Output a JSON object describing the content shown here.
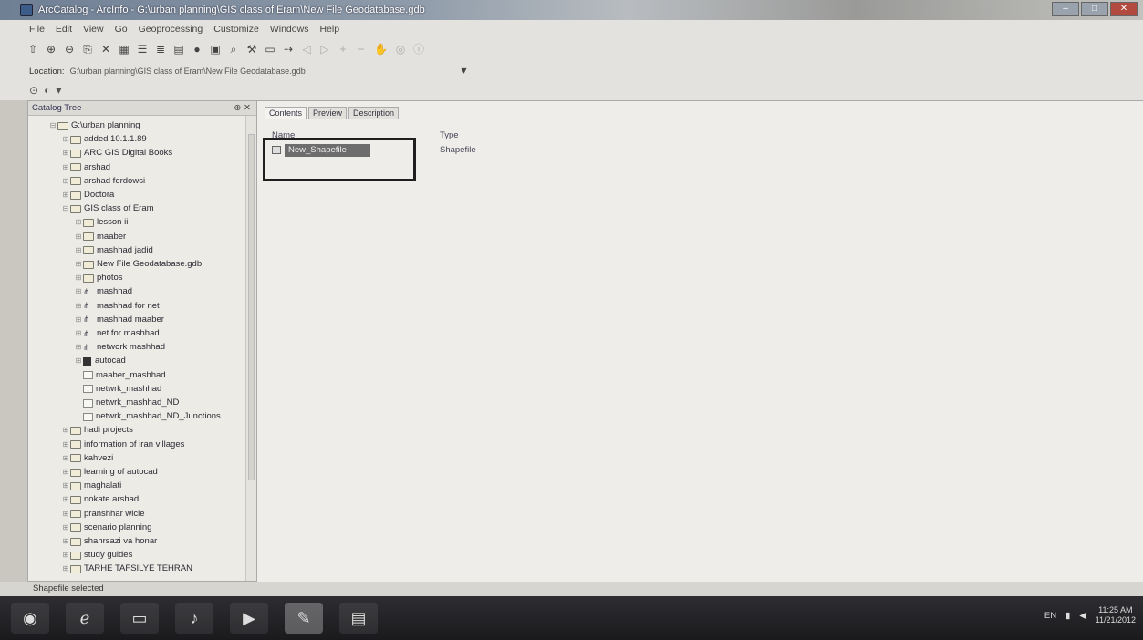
{
  "window": {
    "title": "ArcCatalog - ArcInfo - G:\\urban planning\\GIS class of Eram\\New File Geodatabase.gdb"
  },
  "menu": [
    "File",
    "Edit",
    "View",
    "Go",
    "Geoprocessing",
    "Customize",
    "Windows",
    "Help"
  ],
  "location": {
    "label": "Location:",
    "value": "G:\\urban planning\\GIS class of Eram\\New File Geodatabase.gdb"
  },
  "catalog_tree": {
    "title": "Catalog Tree",
    "pin": "⊕",
    "close": "✕",
    "items": [
      {
        "label": "G:\\urban planning",
        "icon": "folder-icon",
        "level": 0,
        "expander": "⊟"
      },
      {
        "label": "added 10.1.1.89",
        "icon": "folder-icon",
        "level": 1,
        "expander": "⊞"
      },
      {
        "label": "ARC GIS Digital Books",
        "icon": "folder-icon",
        "level": 1,
        "expander": "⊞"
      },
      {
        "label": "arshad",
        "icon": "folder-icon",
        "level": 1,
        "expander": "⊞"
      },
      {
        "label": "arshad ferdowsi",
        "icon": "folder-icon",
        "level": 1,
        "expander": "⊞"
      },
      {
        "label": "Doctora",
        "icon": "folder-icon",
        "level": 1,
        "expander": "⊞"
      },
      {
        "label": "GIS class of Eram",
        "icon": "folder-icon",
        "level": 1,
        "expander": "⊟"
      },
      {
        "label": "lesson ii",
        "icon": "folder-icon",
        "level": 2,
        "expander": "⊞"
      },
      {
        "label": "maaber",
        "icon": "folder-icon",
        "level": 2,
        "expander": "⊞"
      },
      {
        "label": "mashhad jadid",
        "icon": "folder-icon",
        "level": 2,
        "expander": "⊞"
      },
      {
        "label": "New File Geodatabase.gdb",
        "icon": "folder-icon",
        "level": 2,
        "expander": "⊞"
      },
      {
        "label": "photos",
        "icon": "folder-icon",
        "level": 2,
        "expander": "⊞"
      },
      {
        "label": "mashhad",
        "icon": "network-dataset-icon",
        "level": 2,
        "expander": "⊞"
      },
      {
        "label": "mashhad for net",
        "icon": "network-dataset-icon",
        "level": 2,
        "expander": "⊞"
      },
      {
        "label": "mashhad maaber",
        "icon": "network-dataset-icon",
        "level": 2,
        "expander": "⊞"
      },
      {
        "label": "net for mashhad",
        "icon": "network-dataset-icon",
        "level": 2,
        "expander": "⊞"
      },
      {
        "label": "network mashhad",
        "icon": "network-dataset-icon",
        "level": 2,
        "expander": "⊞"
      },
      {
        "label": "autocad",
        "icon": "cad-icon",
        "level": 2,
        "expander": "⊞"
      },
      {
        "label": "maaber_mashhad",
        "icon": "shapefile-icon",
        "level": 2,
        "expander": ""
      },
      {
        "label": "netwrk_mashhad",
        "icon": "shapefile-icon",
        "level": 2,
        "expander": ""
      },
      {
        "label": "netwrk_mashhad_ND",
        "icon": "shapefile-icon",
        "level": 2,
        "expander": ""
      },
      {
        "label": "netwrk_mashhad_ND_Junctions",
        "icon": "shapefile-icon",
        "level": 2,
        "expander": ""
      },
      {
        "label": "hadi projects",
        "icon": "folder-icon",
        "level": 1,
        "expander": "⊞"
      },
      {
        "label": "information of iran villages",
        "icon": "folder-icon",
        "level": 1,
        "expander": "⊞"
      },
      {
        "label": "kahvezi",
        "icon": "folder-icon",
        "level": 1,
        "expander": "⊞"
      },
      {
        "label": "learning of autocad",
        "icon": "folder-icon",
        "level": 1,
        "expander": "⊞"
      },
      {
        "label": "maghalati",
        "icon": "folder-icon",
        "level": 1,
        "expander": "⊞"
      },
      {
        "label": "nokate arshad",
        "icon": "folder-icon",
        "level": 1,
        "expander": "⊞"
      },
      {
        "label": "pranshhar wicle",
        "icon": "folder-icon",
        "level": 1,
        "expander": "⊞"
      },
      {
        "label": "scenario planning",
        "icon": "folder-icon",
        "level": 1,
        "expander": "⊞"
      },
      {
        "label": "shahrsazi va honar",
        "icon": "folder-icon",
        "level": 1,
        "expander": "⊞"
      },
      {
        "label": "study guides",
        "icon": "folder-icon",
        "level": 1,
        "expander": "⊞"
      },
      {
        "label": "TARHE TAFSILYE TEHRAN",
        "icon": "folder-icon",
        "level": 1,
        "expander": "⊞"
      }
    ]
  },
  "tabs": [
    {
      "label": "Contents",
      "active": true
    },
    {
      "label": "Preview",
      "active": false
    },
    {
      "label": "Description",
      "active": false
    }
  ],
  "contents": {
    "columns": {
      "name": "Name",
      "type": "Type"
    },
    "rows": [
      {
        "name": "New_Shapefile",
        "type": "Shapefile"
      }
    ]
  },
  "status": {
    "text": "Shapefile selected"
  },
  "taskbar": {
    "buttons": [
      "start-orb-icon",
      "browser-icon",
      "file-explorer-icon",
      "media-icon",
      "player-icon",
      "arccatalog-icon",
      "document-icon"
    ],
    "tray": {
      "lang": "EN",
      "time": "11:25 AM",
      "date": "11/21/2012"
    }
  }
}
